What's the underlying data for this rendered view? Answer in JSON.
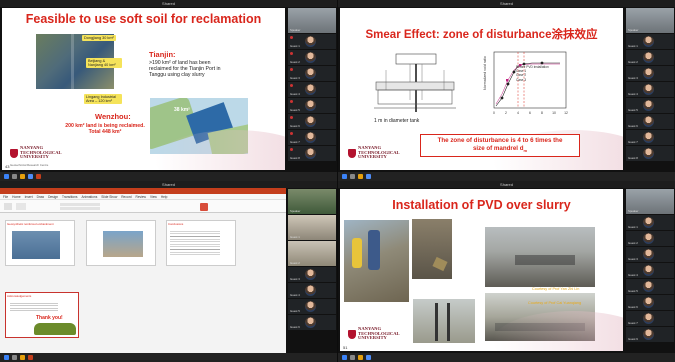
{
  "window_titles": [
    "Shared",
    "Shared",
    "Shared",
    "Shared"
  ],
  "slide1": {
    "title": "Feasible to use soft soil for reclamation",
    "map_labels": [
      "Dongjiang 30 km²",
      "Beijiang & Nanjiang 40 km²",
      "Lingang Industrial Area – 120 km²"
    ],
    "tianjin_heading": "Tianjin:",
    "tianjin_text": ">190 km² of land has been reclaimed for the Tianjin Port in Tanggu using clay slurry",
    "wenzhou_heading": "Wenzhou:",
    "wenzhou_text": "200 km² land is being reclaimed. Total 448 km²",
    "wenzhou_map_label": "38 km²",
    "page_number": "43",
    "footer": "Geotechnical Research Centre"
  },
  "slide2": {
    "title": "Smear Effect: zone of disturbance涂抹效应",
    "tank_caption": "1 m in diameter tank",
    "ylabel": "Normalized void ratio",
    "note_line1": "The zone of disturbance is 4 to 6 times the",
    "note_line2": "size of mandrel d",
    "note_subscript": "m",
    "legend": [
      "Before PVD installation",
      "Case 1",
      "Case 2",
      "Case 3"
    ],
    "xticks": [
      "0",
      "2",
      "4",
      "6",
      "8",
      "10",
      "12"
    ]
  },
  "slide3": {
    "ribbon_tabs": [
      "File",
      "Home",
      "Insert",
      "Draw",
      "Design",
      "Transitions",
      "Animations",
      "Slide Show",
      "Record",
      "Review",
      "View",
      "Help"
    ],
    "thumb_titles": [
      "Geosynthetic reinforced embankment",
      "",
      "Conclusions"
    ],
    "thank_you": "Thank you!",
    "ack_title": "Acknowledgements"
  },
  "slide4": {
    "title": "Installation of PVD over slurry",
    "caption1": "Courtesy of Prof Yan Zhi Lin",
    "caption2": "Courtesy of Prof Cai Yuanqiang",
    "page_number": "51"
  },
  "gallery_names": [
    "Speaker",
    "Guest 1",
    "Guest 2",
    "Guest 3",
    "Guest 4",
    "Guest 5",
    "Guest 6",
    "Guest 7",
    "Guest 8",
    "Guest 9"
  ],
  "colors": {
    "title_red": "#d9261c",
    "title_dark": "#1a1a1a",
    "ntu_red": "#b3122e",
    "map_label_bg": "#f5e35a"
  }
}
